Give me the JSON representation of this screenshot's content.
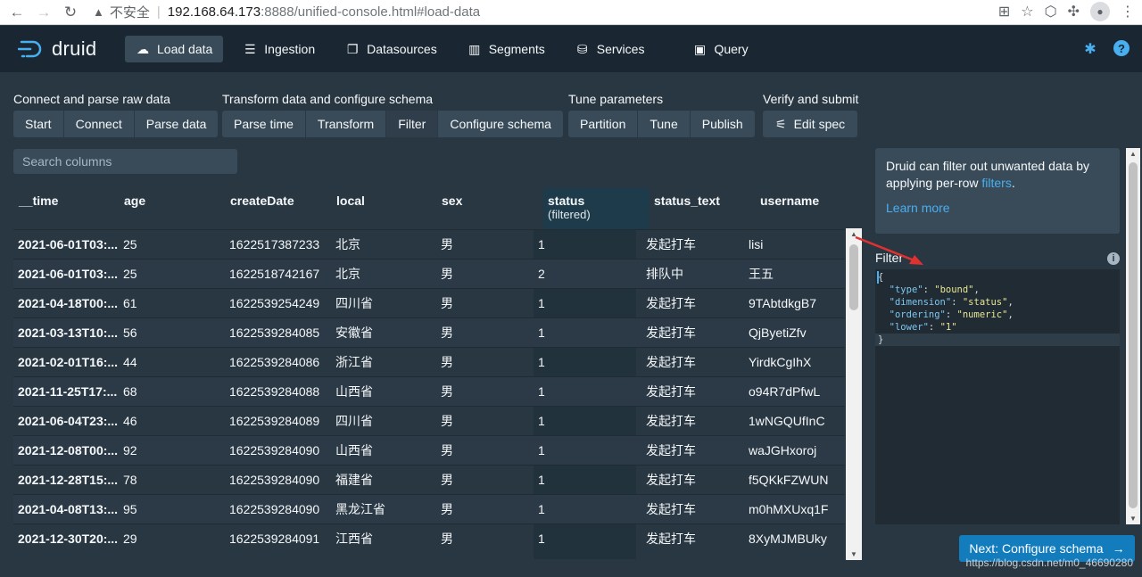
{
  "browser": {
    "insecure_label": "不安全",
    "url_host": "192.168.64.173",
    "url_path": ":8888/unified-console.html#load-data"
  },
  "header": {
    "logo_text": "druid",
    "tabs": [
      {
        "label": "Load data",
        "icon": "cloud-upload-icon",
        "active": true
      },
      {
        "label": "Ingestion",
        "icon": "gantt-chart-icon"
      },
      {
        "label": "Datasources",
        "icon": "datasource-icon"
      },
      {
        "label": "Segments",
        "icon": "segments-icon"
      },
      {
        "label": "Services",
        "icon": "database-icon"
      },
      {
        "label": "Query",
        "icon": "application-icon"
      }
    ]
  },
  "steps": [
    {
      "title": "Connect and parse raw data",
      "buttons": [
        "Start",
        "Connect",
        "Parse data"
      ]
    },
    {
      "title": "Transform data and configure schema",
      "buttons": [
        "Parse time",
        "Transform",
        "Filter",
        "Configure schema"
      ],
      "active": "Filter"
    },
    {
      "title": "Tune parameters",
      "buttons": [
        "Partition",
        "Tune",
        "Publish"
      ]
    },
    {
      "title": "Verify and submit",
      "buttons": [
        "Edit spec"
      ]
    }
  ],
  "search": {
    "placeholder": "Search columns"
  },
  "table": {
    "columns": [
      "__time",
      "age",
      "createDate",
      "local",
      "sex",
      "status",
      "status_text",
      "username"
    ],
    "filtered_note": "(filtered)",
    "rows": [
      [
        "2021-06-01T03:...",
        "25",
        "1622517387233",
        "北京",
        "男",
        "1",
        "发起打车",
        "lisi"
      ],
      [
        "2021-06-01T03:...",
        "25",
        "1622518742167",
        "北京",
        "男",
        "2",
        "排队中",
        "王五"
      ],
      [
        "2021-04-18T00:...",
        "61",
        "1622539254249",
        "四川省",
        "男",
        "1",
        "发起打车",
        "9TAbtdkgB7"
      ],
      [
        "2021-03-13T10:...",
        "56",
        "1622539284085",
        "安徽省",
        "男",
        "1",
        "发起打车",
        "QjByetiZfv"
      ],
      [
        "2021-02-01T16:...",
        "44",
        "1622539284086",
        "浙江省",
        "男",
        "1",
        "发起打车",
        "YirdkCgIhX"
      ],
      [
        "2021-11-25T17:...",
        "68",
        "1622539284088",
        "山西省",
        "男",
        "1",
        "发起打车",
        "o94R7dPfwL"
      ],
      [
        "2021-06-04T23:...",
        "46",
        "1622539284089",
        "四川省",
        "男",
        "1",
        "发起打车",
        "1wNGQUfInC"
      ],
      [
        "2021-12-08T00:...",
        "92",
        "1622539284090",
        "山西省",
        "男",
        "1",
        "发起打车",
        "waJGHxoroj"
      ],
      [
        "2021-12-28T15:...",
        "78",
        "1622539284090",
        "福建省",
        "男",
        "1",
        "发起打车",
        "f5QKkFZWUN"
      ],
      [
        "2021-04-08T13:...",
        "95",
        "1622539284090",
        "黑龙江省",
        "男",
        "1",
        "发起打车",
        "m0hMXUxq1F"
      ],
      [
        "2021-12-30T20:...",
        "29",
        "1622539284091",
        "江西省",
        "男",
        "1",
        "发起打车",
        "8XyMJMBUky"
      ]
    ]
  },
  "panel": {
    "info_text": "Druid can filter out unwanted data by applying per-row ",
    "info_link": "filters",
    "info_end": ".",
    "learn_more": "Learn more",
    "filter_label": "Filter",
    "filter_json": {
      "open": "{",
      "type_key": "\"type\"",
      "type_val": "\"bound\"",
      "dimension_key": "\"dimension\"",
      "dimension_val": "\"status\"",
      "ordering_key": "\"ordering\"",
      "ordering_val": "\"numeric\"",
      "lower_key": "\"lower\"",
      "lower_val": "\"1\"",
      "close": "}"
    },
    "next_button": "Next: Configure schema"
  },
  "watermark": "https://blog.csdn.net/m0_46690280",
  "colors": {
    "accent": "#48aff0",
    "primary_button": "#137cbd",
    "annotation_arrow": "#e03131"
  }
}
